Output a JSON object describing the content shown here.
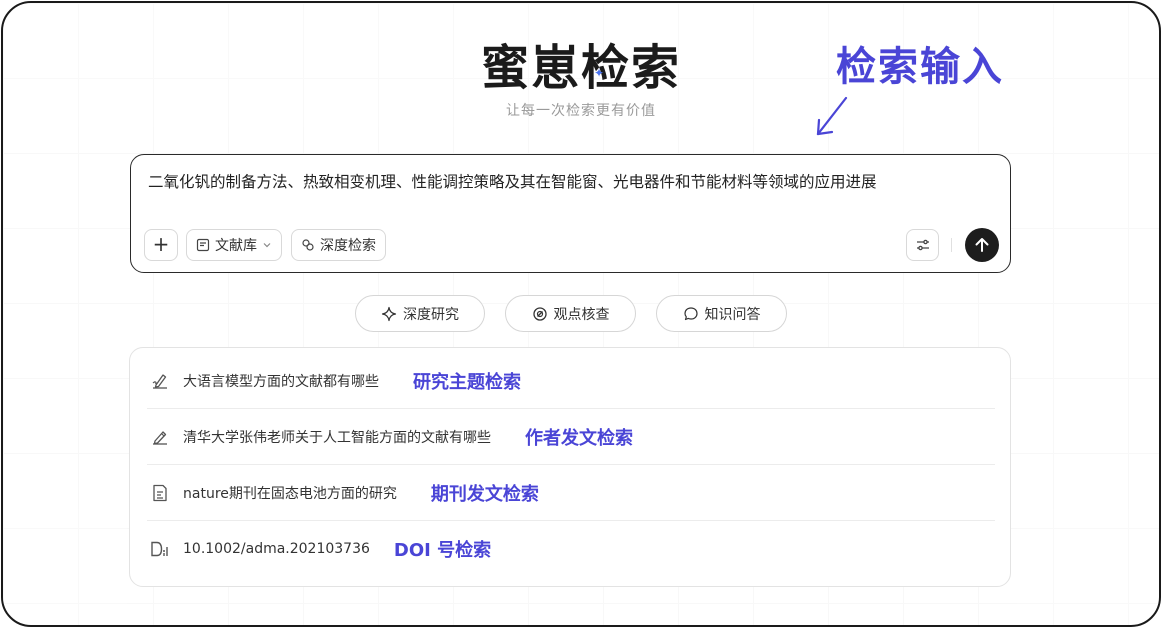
{
  "app": {
    "logo": "蜜崽检索",
    "tagline": "让每一次检索更有价值"
  },
  "annotation": {
    "main_label": "检索输入",
    "color": "#4a45d6"
  },
  "search": {
    "query": "二氧化钒的制备方法、热致相变机理、性能调控策略及其在智能窗、光电器件和节能材料等领域的应用进展",
    "add_button": "+",
    "library_label": "文献库",
    "deep_search_label": "深度检索",
    "settings_icon": "sliders-icon",
    "send_icon": "arrow-up-icon"
  },
  "modes": [
    {
      "label": "深度研究",
      "icon": "sparkle-icon"
    },
    {
      "label": "观点核查",
      "icon": "check-circle-icon"
    },
    {
      "label": "知识问答",
      "icon": "chat-bubble-icon"
    }
  ],
  "examples": [
    {
      "text": "大语言模型方面的文献都有哪些",
      "tag": "研究主题检索",
      "icon": "pen-doc-icon"
    },
    {
      "text": "清华大学张伟老师关于人工智能方面的文献有哪些",
      "tag": "作者发文检索",
      "icon": "edit-icon"
    },
    {
      "text": "nature期刊在固态电池方面的研究",
      "tag": "期刊发文检索",
      "icon": "journal-icon"
    },
    {
      "text": "10.1002/adma.202103736",
      "tag": "DOI 号检索",
      "icon": "doi-icon"
    }
  ]
}
